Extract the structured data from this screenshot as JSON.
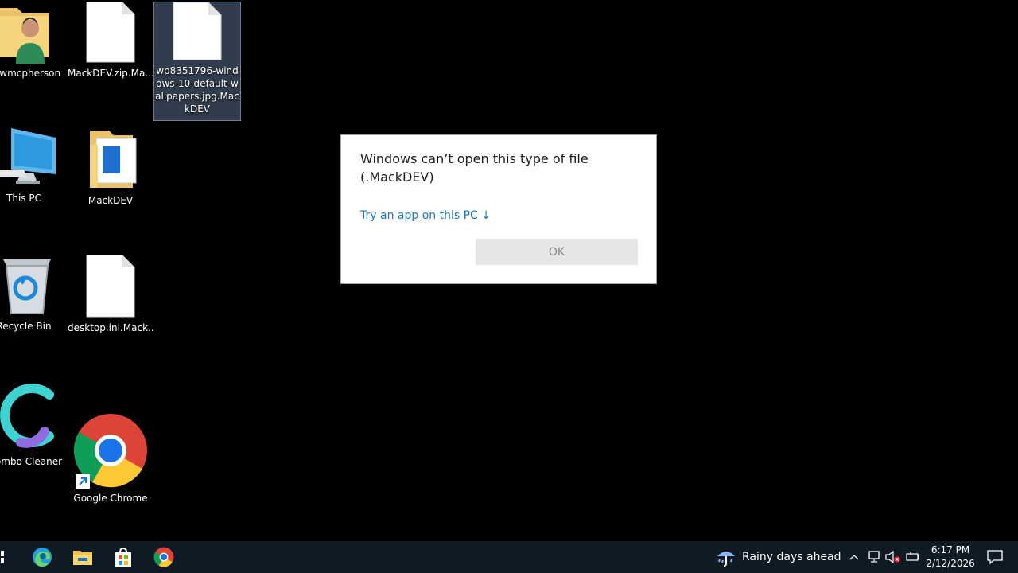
{
  "desktop": {
    "icons": [
      {
        "label": "irewmcpherson"
      },
      {
        "label": "MackDEV.zip.Ma..."
      },
      {
        "label": "wp8351796-windows-10-default-wallpapers.jpg.MackDEV"
      },
      {
        "label": "This PC"
      },
      {
        "label": "MackDEV"
      },
      {
        "label": "Recycle Bin"
      },
      {
        "label": "desktop.ini.Mack..."
      },
      {
        "label": "ombo Cleaner"
      },
      {
        "label": "Google Chrome"
      }
    ]
  },
  "dialog": {
    "message": "Windows can’t open this type of file (.MackDEV)",
    "link": "Try an app on this PC ↓",
    "ok_label": "OK"
  },
  "taskbar": {
    "apps": [
      {
        "icon": "windows-start-icon"
      },
      {
        "icon": "edge-icon"
      },
      {
        "icon": "file-explorer-icon"
      },
      {
        "icon": "store-icon"
      },
      {
        "icon": "chrome-icon"
      }
    ],
    "weather": {
      "icon": "umbrella-rain-icon",
      "text": "Rainy days ahead"
    },
    "tray": {
      "time": "6:17 PM",
      "date": "2/12/2026"
    }
  },
  "colors": {
    "accent_link": "#1a7abf",
    "taskbar_bg": "#101a24",
    "desktop_bg": "#000000"
  }
}
